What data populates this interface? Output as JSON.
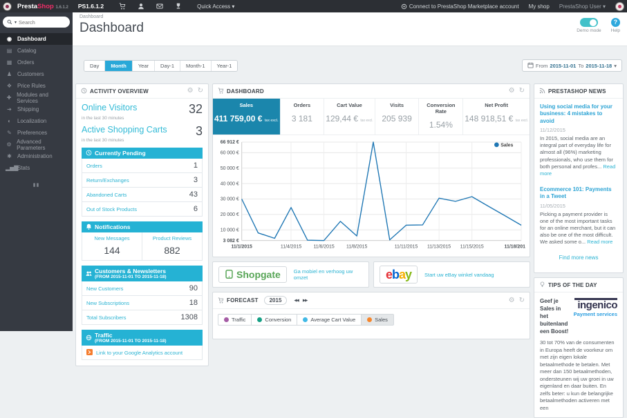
{
  "topbar": {
    "brand_presta": "Presta",
    "brand_shop": "Shop",
    "brand_version": "1.6.1.2",
    "shop_version": "PS1.6.1.2",
    "quick_access_label": "Quick Access",
    "marketplace_link": "Connect to PrestaShop Marketplace account",
    "my_shop_label": "My shop",
    "user_label": "PrestaShop User"
  },
  "icons": {
    "gear": "⚙",
    "refresh": "↻",
    "caret_down": "▾",
    "prev": "◀◀",
    "next": "▶▶",
    "collapse": "▮▮"
  },
  "sidebar": {
    "search_placeholder": "Search",
    "items": [
      {
        "label": "Dashboard"
      },
      {
        "label": "Catalog"
      },
      {
        "label": "Orders"
      },
      {
        "label": "Customers"
      },
      {
        "label": "Price Rules"
      },
      {
        "label": "Modules and Services"
      },
      {
        "label": "Shipping"
      },
      {
        "label": "Localization"
      },
      {
        "label": "Preferences"
      },
      {
        "label": "Advanced Parameters"
      },
      {
        "label": "Administration"
      },
      {
        "label": "Stats"
      }
    ]
  },
  "header": {
    "breadcrumb": "Dashboard",
    "title": "Dashboard",
    "demo_mode_label": "Demo mode",
    "help_label": "Help"
  },
  "filters": {
    "buttons": [
      "Day",
      "Month",
      "Year",
      "Day-1",
      "Month-1",
      "Year-1"
    ],
    "active_button": "Month",
    "from_label": "From",
    "from_date": "2015-11-01",
    "to_label": "To",
    "to_date": "2015-11-18"
  },
  "activity": {
    "title": "ACTIVITY OVERVIEW",
    "online_visitors_label": "Online Visitors",
    "online_visitors_value": "32",
    "online_visitors_sub": "in the last 30 minutes",
    "active_carts_label": "Active Shopping Carts",
    "active_carts_value": "3",
    "active_carts_sub": "in the last 30 minutes",
    "pending": {
      "title": "Currently Pending",
      "rows": [
        {
          "label": "Orders",
          "value": "1"
        },
        {
          "label": "Return/Exchanges",
          "value": "3"
        },
        {
          "label": "Abandoned Carts",
          "value": "43"
        },
        {
          "label": "Out of Stock Products",
          "value": "6"
        }
      ]
    },
    "notifications": {
      "title": "Notifications",
      "cols": [
        {
          "label": "New Messages",
          "value": "144"
        },
        {
          "label": "Product Reviews",
          "value": "882"
        }
      ]
    },
    "customers": {
      "title": "Customers & Newsletters",
      "subtitle": "(FROM 2015-11-01 TO 2015-11-18)",
      "rows": [
        {
          "label": "New Customers",
          "value": "90"
        },
        {
          "label": "New Subscriptions",
          "value": "18"
        },
        {
          "label": "Total Subscribers",
          "value": "1308"
        }
      ]
    },
    "traffic": {
      "title": "Traffic",
      "subtitle": "(FROM 2015-11-01 TO 2015-11-18)",
      "link": "Link to your Google Analytics account"
    }
  },
  "dashboard_panel": {
    "title": "DASHBOARD",
    "kpis": [
      {
        "label": "Sales",
        "value": "411 759,00 €",
        "suffix": "tax excl."
      },
      {
        "label": "Orders",
        "value": "3 181",
        "suffix": ""
      },
      {
        "label": "Cart Value",
        "value": "129,44 €",
        "suffix": "tax excl."
      },
      {
        "label": "Visits",
        "value": "205 939",
        "suffix": ""
      },
      {
        "label": "Conversion Rate",
        "value": "1.54%",
        "suffix": ""
      },
      {
        "label": "Net Profit",
        "value": "148 918,51 €",
        "suffix": "tax excl."
      }
    ]
  },
  "chart_data": {
    "type": "line",
    "title": "Sales",
    "legend": [
      "Sales"
    ],
    "legend_position": "top-right",
    "grid": true,
    "line_color": "#1f77b4",
    "ylim": [
      3082,
      66912
    ],
    "x": [
      "11/1/2015",
      "11/2/2015",
      "11/3/2015",
      "11/4/2015",
      "11/5/2015",
      "11/6/2015",
      "11/7/2015",
      "11/8/2015",
      "11/9/2015",
      "11/10/2015",
      "11/11/2015",
      "11/12/2015",
      "11/13/2015",
      "11/14/2015",
      "11/15/2015",
      "11/16/2015",
      "11/17/2015",
      "11/18/2015"
    ],
    "values": [
      30000,
      8000,
      4500,
      24500,
      3300,
      3082,
      15500,
      6000,
      66912,
      3500,
      13000,
      13200,
      30500,
      28500,
      31500,
      25300,
      19200,
      13000
    ],
    "yticks": [
      {
        "value": 66912,
        "label": "66 912 €",
        "bold": true
      },
      {
        "value": 60000,
        "label": "60 000 €"
      },
      {
        "value": 50000,
        "label": "50 000 €"
      },
      {
        "value": 40000,
        "label": "40 000 €"
      },
      {
        "value": 30000,
        "label": "30 000 €"
      },
      {
        "value": 20000,
        "label": "20 000 €"
      },
      {
        "value": 10000,
        "label": "10 000 €"
      },
      {
        "value": 3082,
        "label": "3 082 €",
        "bold": true
      }
    ],
    "xticks": [
      {
        "day": 1,
        "label": "11/1/2015",
        "bold": true
      },
      {
        "day": 4,
        "label": "11/4/2015"
      },
      {
        "day": 6,
        "label": "11/6/2015"
      },
      {
        "day": 8,
        "label": "11/8/2015"
      },
      {
        "day": 11,
        "label": "11/11/2015"
      },
      {
        "day": 13,
        "label": "11/13/2015"
      },
      {
        "day": 15,
        "label": "11/15/2015"
      },
      {
        "day": 18,
        "label": "11/18/201",
        "bold": true
      }
    ]
  },
  "promos": {
    "shopgate": {
      "brand": "Shopgate",
      "link": "Ga mobiel en verhoog uw omzet"
    },
    "ebay": {
      "brand": "ebay",
      "link": "Start uw eBay winkel vandaag"
    }
  },
  "forecast": {
    "title": "FORECAST",
    "year": "2015",
    "legend": [
      {
        "label": "Traffic",
        "color": "#a55ca5"
      },
      {
        "label": "Conversion",
        "color": "#16a085"
      },
      {
        "label": "Average Cart Value",
        "color": "#41b9e6"
      },
      {
        "label": "Sales",
        "color": "#f5862c",
        "active": true
      }
    ]
  },
  "news": {
    "title": "PRESTASHOP NEWS",
    "items": [
      {
        "headline": "Using social media for your business: 4 mistakes to avoid",
        "date": "11/12/2015",
        "body": "In 2015, social media are an integral part of everyday life for almost all (96%) marketing professionals, who use them for both personal and profes...",
        "read_more": "Read more"
      },
      {
        "headline": "Ecommerce 101: Payments in a Tweet",
        "date": "11/05/2015",
        "body": "Picking a payment provider is one of the most important tasks for an online merchant, but it can also be one of the most difficult. We asked some o...",
        "read_more": "Read more"
      }
    ],
    "footer_link": "Find more news"
  },
  "tips": {
    "title": "TIPS OF THE DAY",
    "heading": "Geef je Sales in het buitenland een Boost!",
    "logo_line1": "ingenico",
    "logo_line2": "Payment services",
    "body": "30 tot 70% van de consumenten in Europa heeft de voorkeur om met zijn eigen lokale betaalmethode te betalen. Met meer dan 150 betaalmethoden, ondersteunen wij uw groei in uw eigenland en daar buiten. En zelfs beter: u kun de belangrijke betaalmethoden activeren met een"
  },
  "colors": {
    "accent_cyan": "#25b2d4",
    "active_kpi_blue": "#1b86ac",
    "active_filter_blue": "#29a8d8",
    "link_cyan": "#2bb3d2",
    "chart_line_blue": "#1f77b4",
    "topbar_dark": "#2c2f34",
    "sidebar_dark": "#363a42",
    "brand_pink": "#ed2e67",
    "ga_orange": "#f57c2d"
  }
}
